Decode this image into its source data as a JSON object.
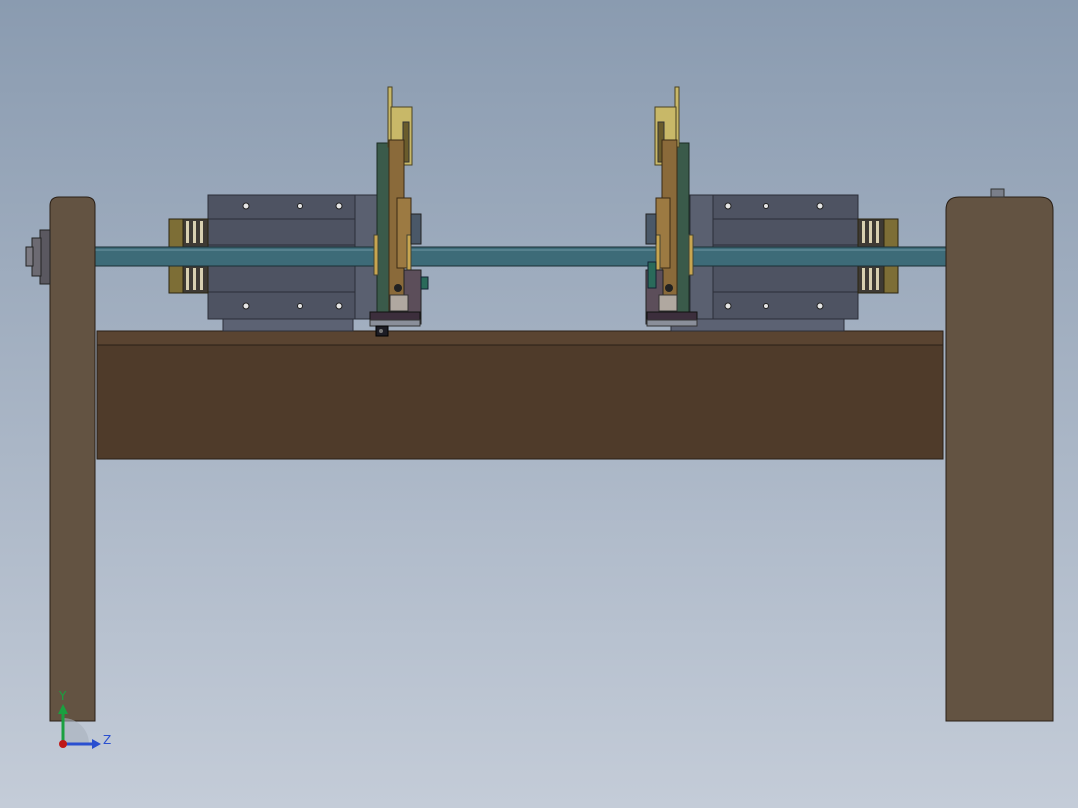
{
  "viewport": {
    "background_top": "#8a9bb0",
    "background_bottom": "#c4ccd8"
  },
  "triad": {
    "y_label": "Y",
    "z_label": "Z",
    "y_color": "#1aa040",
    "z_color": "#2a4fd0",
    "origin_color": "#c01818"
  },
  "colors": {
    "frame": "#635342",
    "beam": "#4f3b2a",
    "shaft": "#3d6b78",
    "housing": "#4e5362",
    "housing_light": "#5c6273",
    "brass": "#9c8a3e",
    "gear_copper": "#8a6a3a",
    "plate_green": "#3a5a4a",
    "plate_yellow": "#c8b868"
  }
}
